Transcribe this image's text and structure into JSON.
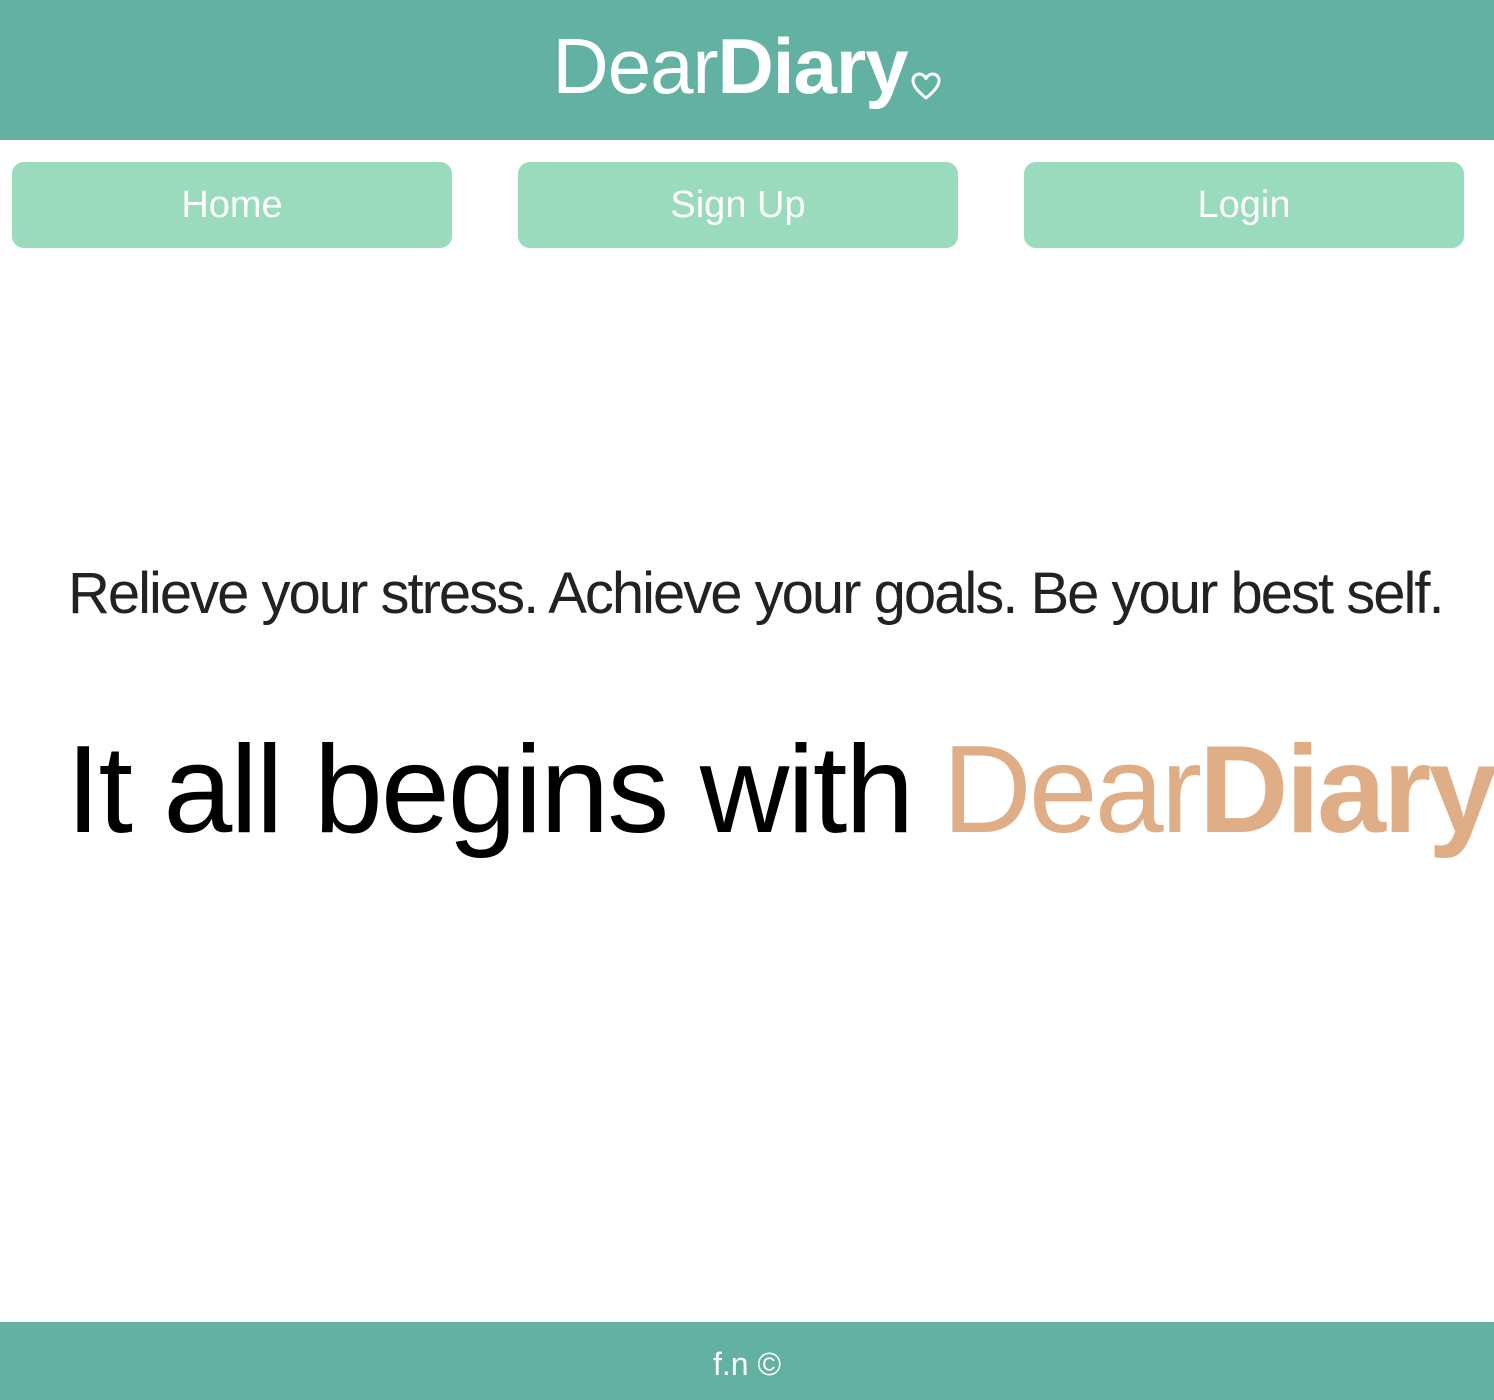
{
  "header": {
    "brand_light": "Dear",
    "brand_bold": "Diary",
    "brand_icon": "heart-outline-icon"
  },
  "nav": {
    "home_label": "Home",
    "signup_label": "Sign Up",
    "login_label": "Login"
  },
  "main": {
    "tagline": "Relieve your stress. Achieve your goals. Be your best self.",
    "hero_lead": "It all begins with",
    "hero_brand_light": "Dear",
    "hero_brand_bold": "Diary",
    "hero_icon": "heart-outline-icon"
  },
  "footer": {
    "text": "f.n ©"
  },
  "colors": {
    "header_bg": "#63b1a3",
    "nav_button_bg": "#9bdbbd",
    "brand_accent": "#e0ae86",
    "footer_bg": "#63b1a3"
  }
}
